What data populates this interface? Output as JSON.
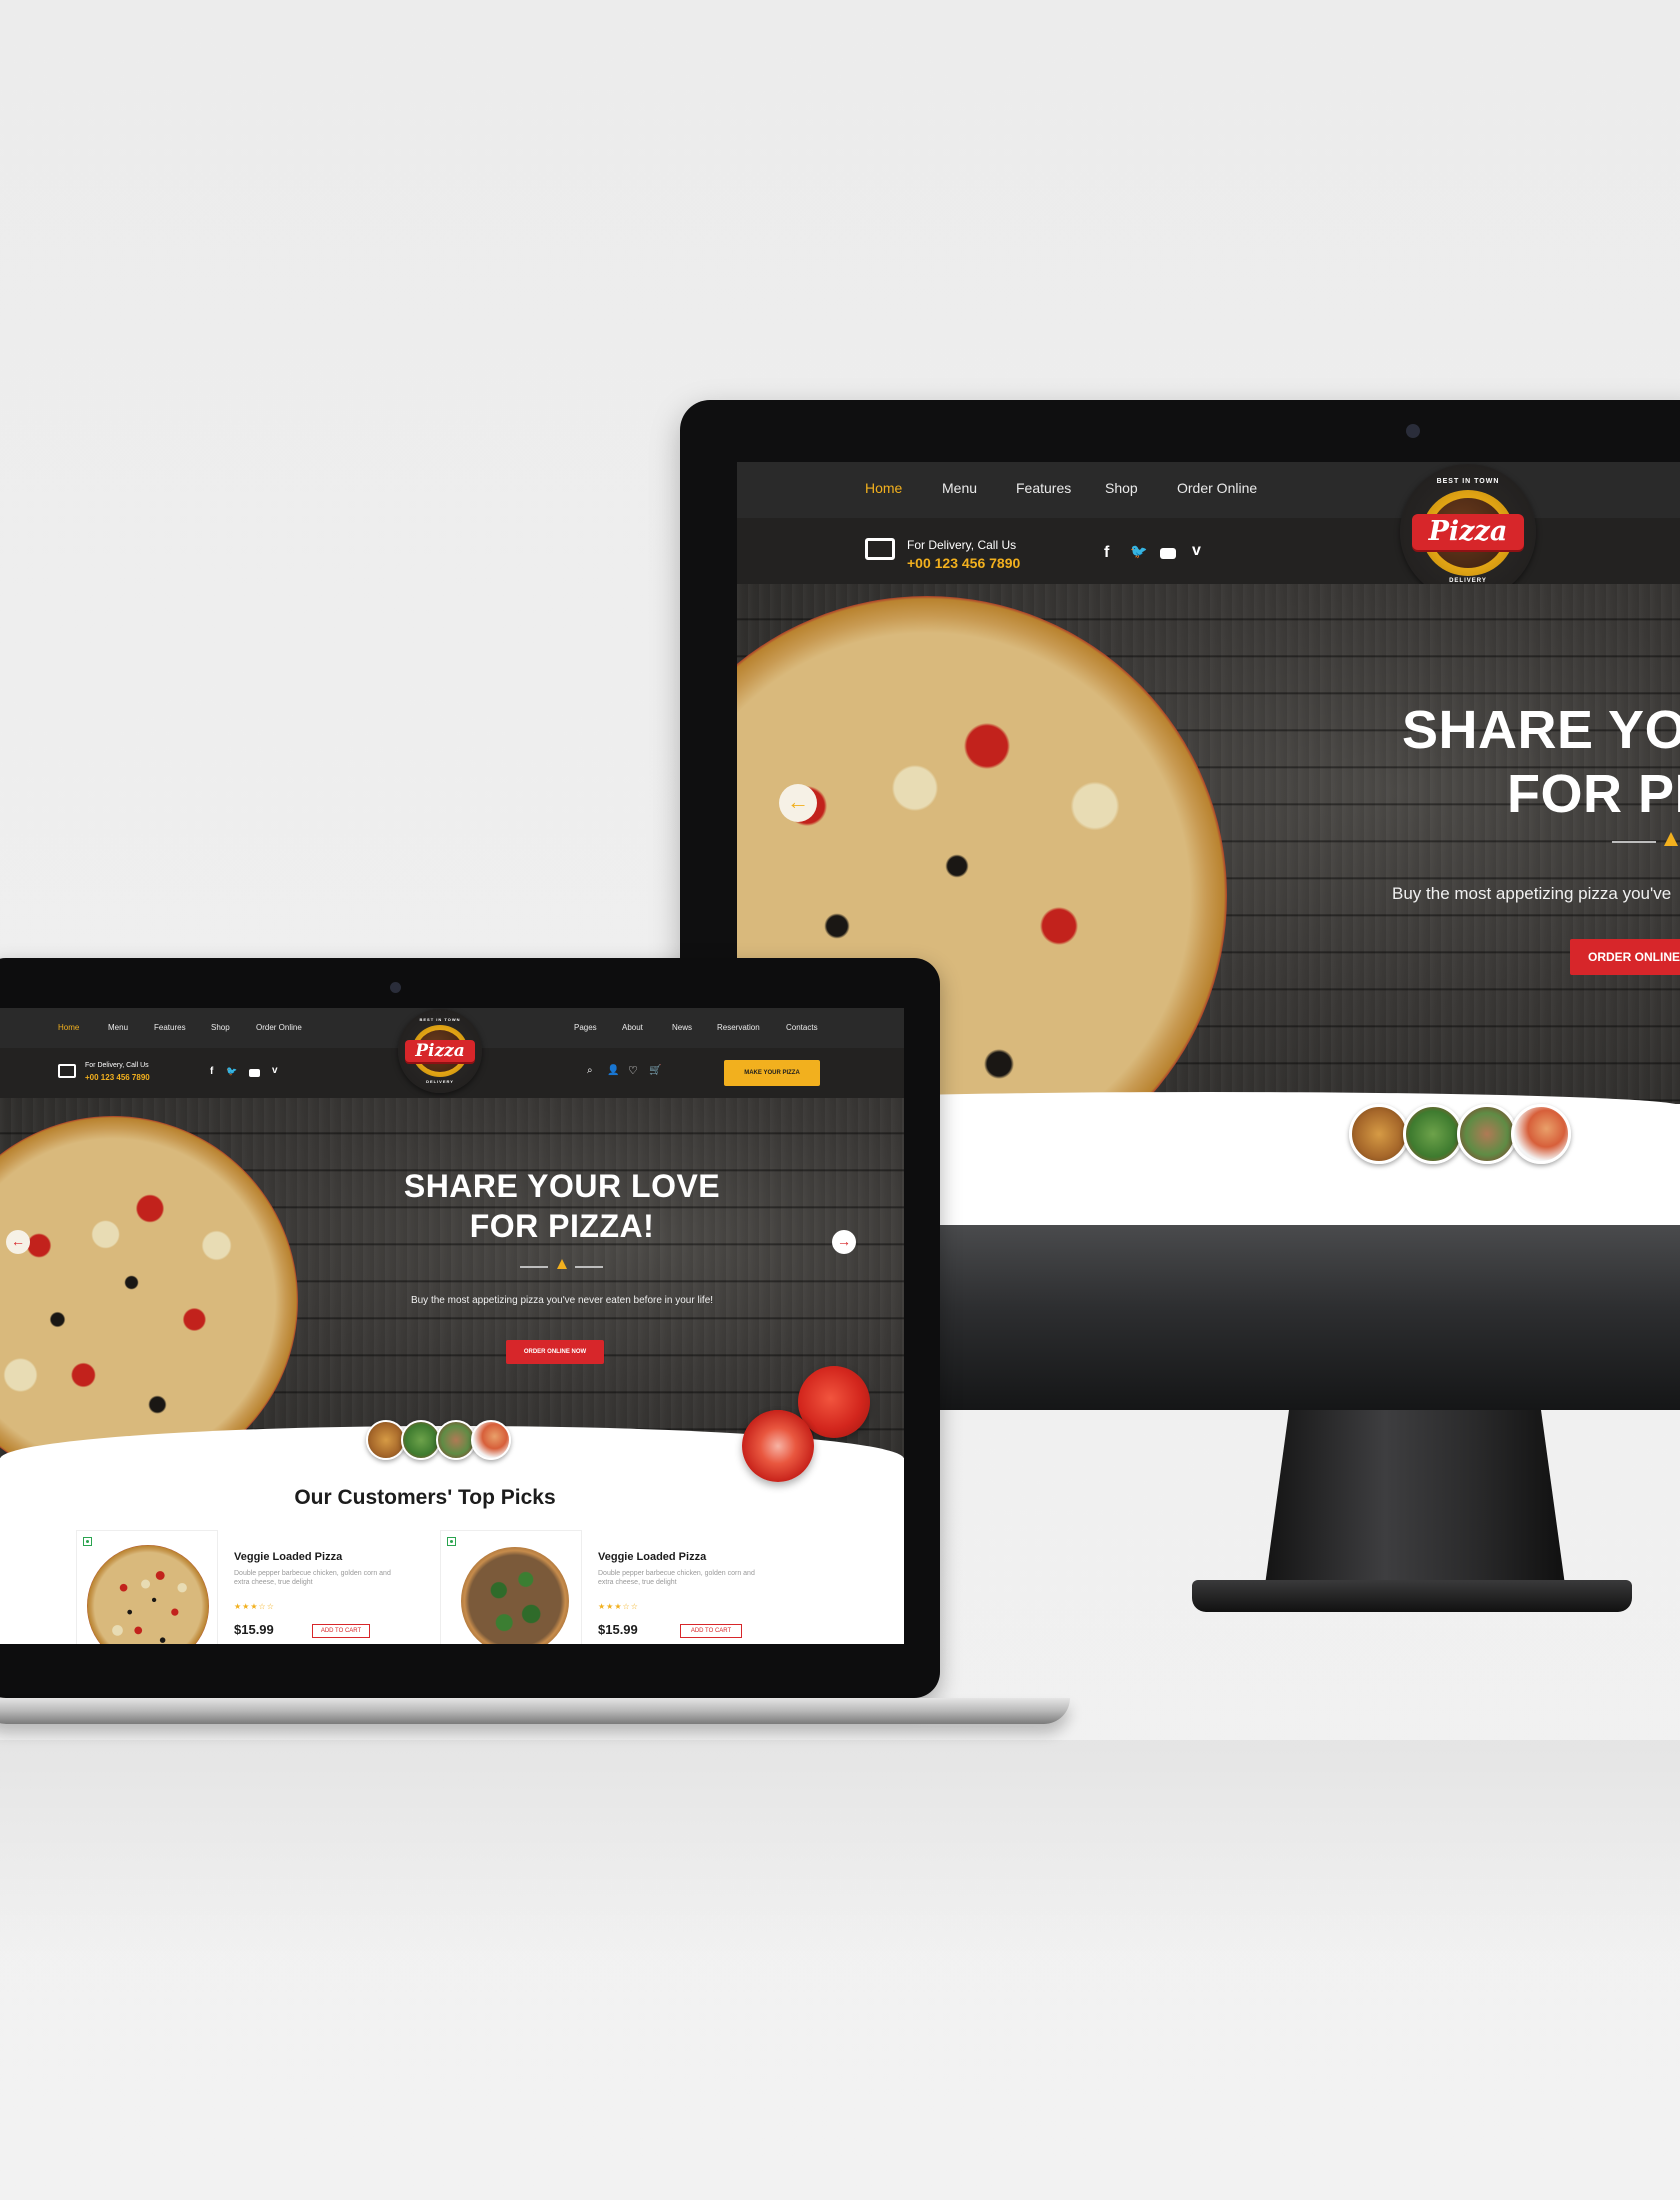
{
  "nav": {
    "left_links": [
      "Home",
      "Menu",
      "Features",
      "Shop",
      "Order Online"
    ],
    "right_links": [
      "Pages",
      "About",
      "News",
      "Reservation",
      "Contacts"
    ],
    "active": "Home"
  },
  "logo": {
    "top_text": "BEST IN TOWN",
    "name": "Pizza",
    "bottom_text": "DELIVERY"
  },
  "delivery": {
    "label": "For Delivery, Call Us",
    "phone": "+00 123 456 7890"
  },
  "social_icons": [
    "facebook-icon",
    "twitter-icon",
    "youtube-icon",
    "vimeo-icon"
  ],
  "header_icons": [
    "search-icon",
    "user-icon",
    "heart-icon",
    "cart-icon"
  ],
  "make_pizza_button": "MAKE YOUR PIZZA",
  "hero": {
    "title_line1": "SHARE YOUR LOVE",
    "title_line2": "FOR PIZZA!",
    "subtitle": "Buy the most appetizing pizza you've never eaten before in your life!",
    "cta": "ORDER ONLINE NOW"
  },
  "monitor_hero": {
    "title_line1": "SHARE YO",
    "title_line2": "FOR PI",
    "subtitle": "Buy the most appetizing pizza you've",
    "cta": "ORDER ONLINE N"
  },
  "top_picks": {
    "heading": "Our Customers' Top Picks",
    "products": [
      {
        "name": "Veggie Loaded Pizza",
        "description": "Double pepper barbecue chicken, golden corn and extra cheese, true delight",
        "rating": 3,
        "rating_max": 5,
        "price": "$15.99",
        "button": "ADD TO CART"
      },
      {
        "name": "Veggie Loaded Pizza",
        "description": "Double pepper barbecue chicken, golden corn and extra cheese, true delight",
        "rating": 3,
        "rating_max": 5,
        "price": "$15.99",
        "button": "ADD TO CART"
      }
    ]
  },
  "colors": {
    "accent_yellow": "#f2b01e",
    "accent_red": "#d7262a",
    "nav_bg": "#2a2a2a"
  }
}
